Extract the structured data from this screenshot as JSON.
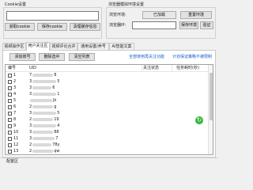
{
  "cookie_section": {
    "title": "Cookie设置",
    "get_cookie": "获取cookie",
    "save_cookie": "保存cookie",
    "clear_cache": "清理缓存信息"
  },
  "browser_section": {
    "title": "浏览器模拟环境设置",
    "env_label": "浏览环境:",
    "env_status": "已加载",
    "reset_env": "重置环境",
    "ip_label": "浏览器IP:",
    "save_env": "保存环境",
    "verify": "验证"
  },
  "tabs": [
    {
      "label": "视频操作区"
    },
    {
      "label": "用户关注区"
    },
    {
      "label": "视频评论合并"
    },
    {
      "label": "通用设置/养号"
    },
    {
      "label": "AI智能文案"
    }
  ],
  "toolbar": {
    "add_account": "添加账号",
    "delete_selected": "删除选中",
    "clear_list": "清空列表"
  },
  "links": {
    "all_follow": "全部使用再关注功能",
    "plan_save": "计划保证策略不被限制"
  },
  "grid": {
    "headers": {
      "index": "编号",
      "uid": "UID",
      "follow_status": "关注状态",
      "task_time": "任务耗时(秒)"
    },
    "rows": [
      {
        "num": "1",
        "uid_prefix": "7",
        "uid_suffix": "8"
      },
      {
        "num": "2",
        "uid_prefix": "3",
        "uid_suffix": "5"
      },
      {
        "num": "3",
        "uid_prefix": "3",
        "uid_suffix": "6"
      },
      {
        "num": "4",
        "uid_prefix": "3",
        "uid_suffix": "1"
      },
      {
        "num": "5",
        "uid_prefix": "",
        "uid_suffix": "Jk"
      },
      {
        "num": "6",
        "uid_prefix": "2",
        "uid_suffix": "g"
      },
      {
        "num": "7",
        "uid_prefix": "3",
        "uid_suffix": "5"
      },
      {
        "num": "8",
        "uid_prefix": "2",
        "uid_suffix": "19"
      },
      {
        "num": "9",
        "uid_prefix": "3",
        "uid_suffix": "4"
      },
      {
        "num": "10",
        "uid_prefix": "3",
        "uid_suffix": "88"
      },
      {
        "num": "11",
        "uid_prefix": "3",
        "uid_suffix": "7"
      },
      {
        "num": "12",
        "uid_prefix": "2",
        "uid_suffix": "78y"
      },
      {
        "num": "13",
        "uid_prefix": "2",
        "uid_suffix": "qw"
      },
      {
        "num": "14",
        "uid_prefix": "3",
        "uid_suffix": "t"
      }
    ]
  },
  "status_bar": {
    "label": "配置区"
  },
  "colors": {
    "link_blue": "#1a5fcc",
    "status_green": "#2fb53c"
  }
}
